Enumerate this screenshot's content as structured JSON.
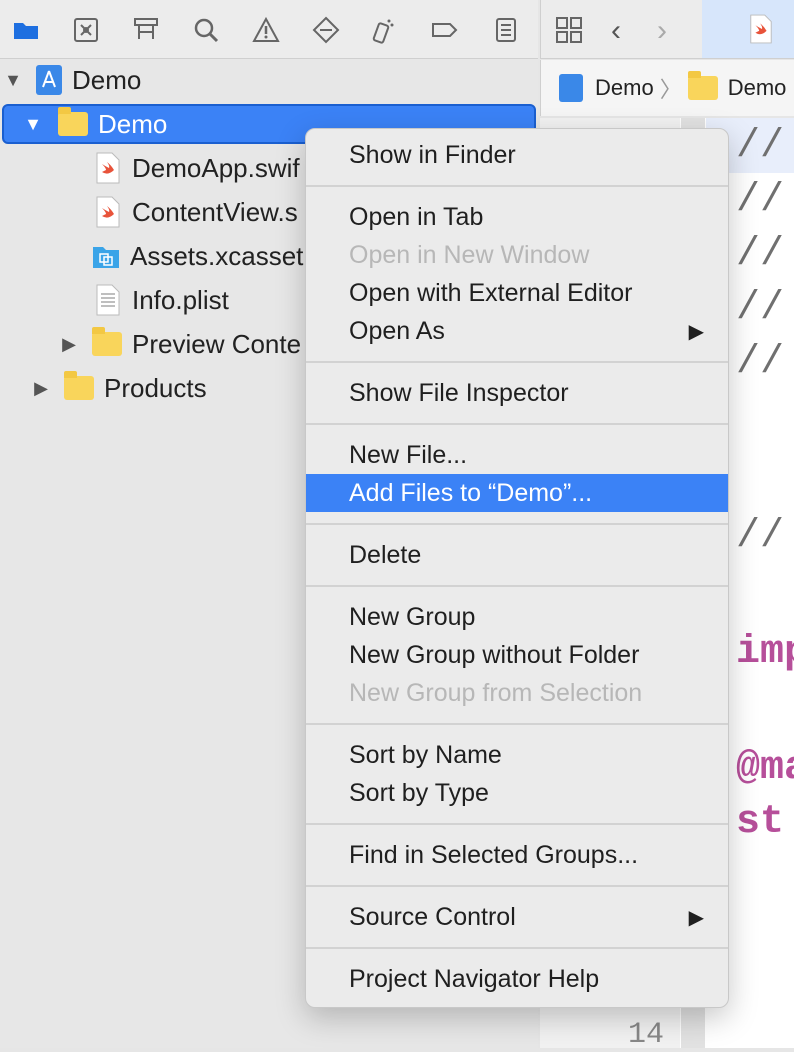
{
  "navigator": {
    "toolbar_icons": [
      "folder-icon",
      "source-control-icon",
      "symbol-icon",
      "find-icon",
      "issue-icon",
      "test-icon",
      "debug-icon",
      "breakpoint-icon",
      "report-icon"
    ],
    "tree": {
      "project": "Demo",
      "group": "Demo",
      "files": [
        "DemoApp.swif",
        "ContentView.s",
        "Assets.xcasset",
        "Info.plist"
      ],
      "preview_folder": "Preview Conte",
      "products": "Products"
    }
  },
  "editor": {
    "breadcrumb": [
      "Demo",
      "Demo"
    ],
    "code_lines": [
      "//",
      "//",
      "//",
      "//",
      "//",
      "//"
    ],
    "keyword_lines": [
      "imp",
      "@ma",
      "st"
    ],
    "line_number": "14"
  },
  "context_menu": {
    "show_in_finder": "Show in Finder",
    "open_in_tab": "Open in Tab",
    "open_in_new_window": "Open in New Window",
    "open_with_external_editor": "Open with External Editor",
    "open_as": "Open As",
    "show_file_inspector": "Show File Inspector",
    "new_file": "New File...",
    "add_files": "Add Files to “Demo”...",
    "delete": "Delete",
    "new_group": "New Group",
    "new_group_without_folder": "New Group without Folder",
    "new_group_from_selection": "New Group from Selection",
    "sort_by_name": "Sort by Name",
    "sort_by_type": "Sort by Type",
    "find_in_selected_groups": "Find in Selected Groups...",
    "source_control": "Source Control",
    "project_navigator_help": "Project Navigator Help"
  },
  "colors": {
    "accent": "#3b82f6",
    "folder": "#f9d55b",
    "keyword": "#b64f9a"
  }
}
